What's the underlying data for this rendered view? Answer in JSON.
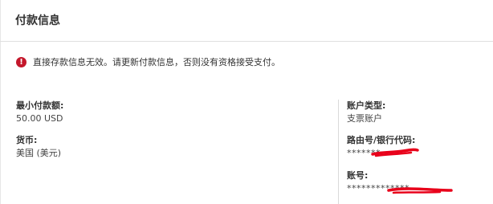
{
  "panel": {
    "title": "付款信息"
  },
  "alert": {
    "icon": "error-icon",
    "color": "#c4172b",
    "text": "直接存款信息无效。请更新付款信息，否则没有资格接受支付。"
  },
  "left_fields": [
    {
      "label": "最小付款额:",
      "value": "50.00 USD"
    },
    {
      "label": "货币:",
      "value": "美国 (美元)"
    }
  ],
  "right_fields": [
    {
      "label": "账户类型:",
      "value": "支票账户"
    },
    {
      "label": "路由号/银行代码:",
      "value": "*******"
    },
    {
      "label": "账号:",
      "value": "*************"
    }
  ],
  "redaction_color": "#e8001a"
}
